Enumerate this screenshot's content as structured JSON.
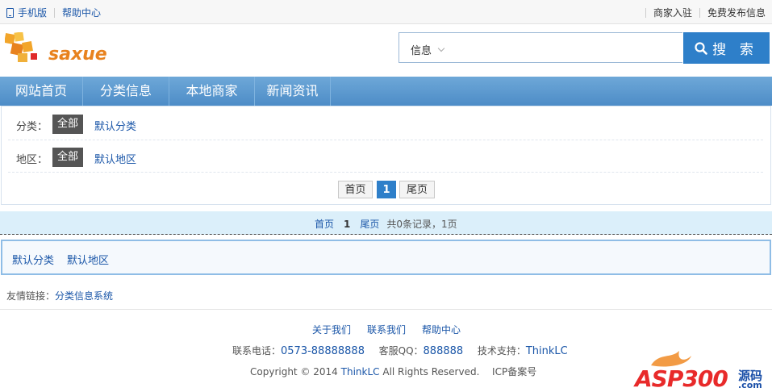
{
  "topbar": {
    "mobile": "手机版",
    "help": "帮助中心",
    "merchant_join": "商家入驻",
    "free_post": "免费发布信息"
  },
  "header": {
    "logo_text": "saxue",
    "search_category": "信息",
    "search_button": "搜 索"
  },
  "nav": {
    "items": [
      "网站首页",
      "分类信息",
      "本地商家",
      "新闻资讯"
    ]
  },
  "filter": {
    "category_label": "分类：",
    "category_all": "全部",
    "category_default": "默认分类",
    "region_label": "地区：",
    "region_all": "全部",
    "region_default": "默认地区"
  },
  "pagination": {
    "first": "首页",
    "current": "1",
    "last": "尾页"
  },
  "strip": {
    "first": "首页",
    "current": "1",
    "last": "尾页",
    "summary": "共0条记录，1页"
  },
  "catbox": {
    "category": "默认分类",
    "region": "默认地区"
  },
  "friends": {
    "label": "友情链接：",
    "link": "分类信息系统"
  },
  "footer": {
    "links": [
      "关于我们",
      "联系我们",
      "帮助中心"
    ],
    "phone_label": "联系电话：",
    "phone": "0573-88888888",
    "qq_label": "客服QQ：",
    "qq": "888888",
    "tech_label": "技术支持：",
    "tech": "ThinkLC",
    "copyright_pre": "Copyright © 2014",
    "copyright_brand": "ThinkLC",
    "copyright_post": "All Rights Reserved.",
    "icp": "ICP备案号"
  },
  "watermark": {
    "text": "ASP300",
    "suffix": "源码",
    "domain": ".com"
  },
  "colors": {
    "accent": "#2e7fc9",
    "nav": "#5a97cf",
    "logo_orange": "#e8821e"
  }
}
